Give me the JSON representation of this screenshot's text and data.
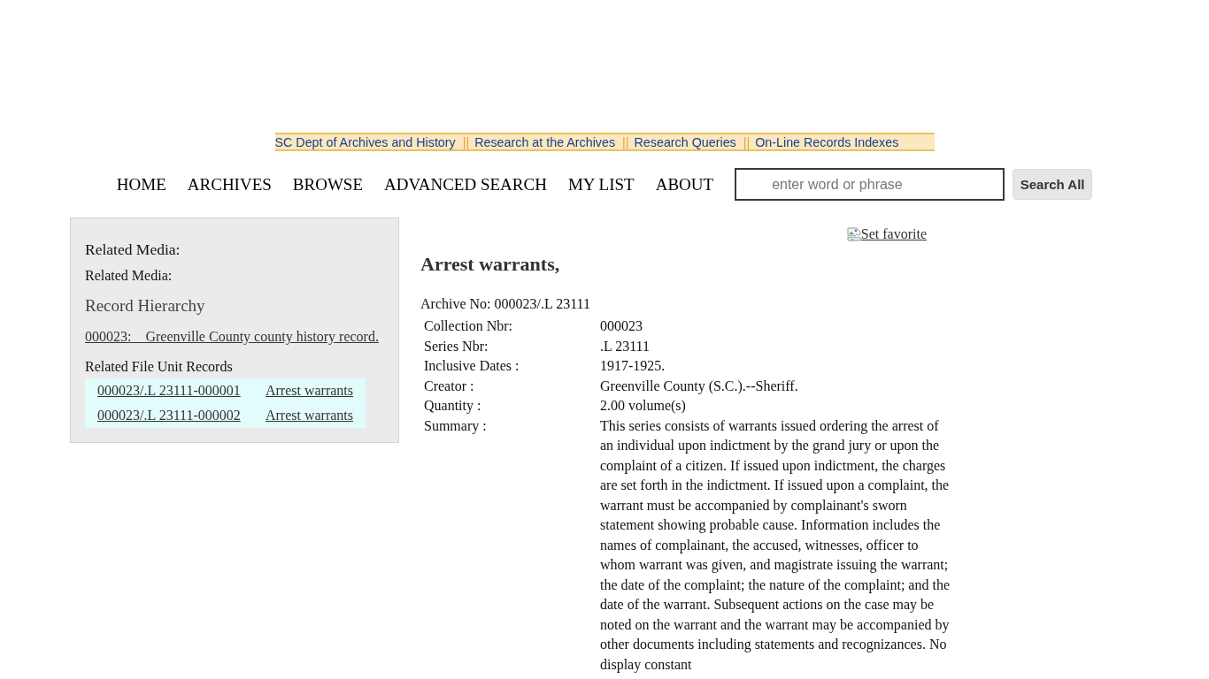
{
  "top_bar": {
    "items": [
      {
        "kind": "link",
        "label": "SC Dept of Archives and History"
      },
      {
        "kind": "separator",
        "label": "||"
      },
      {
        "kind": "link",
        "label": "Research at the Archives"
      },
      {
        "kind": "separator",
        "label": "||"
      },
      {
        "kind": "link",
        "label": "Research Queries"
      },
      {
        "kind": "separator",
        "label": "||"
      },
      {
        "kind": "link",
        "label": "On-Line Records Indexes"
      }
    ]
  },
  "nav": {
    "items": [
      {
        "label": "HOME"
      },
      {
        "label": "ARCHIVES"
      },
      {
        "label": "BROWSE"
      },
      {
        "label": "ADVANCED SEARCH"
      },
      {
        "label": "MY LIST"
      },
      {
        "label": "ABOUT"
      }
    ]
  },
  "search": {
    "placeholder": "enter word or phrase",
    "button": "Search All"
  },
  "sidebar": {
    "heading": "Related Media:",
    "subheading": "Related Media:",
    "hierarchy_title": "Record Hierarchy",
    "hierarchy_link": "000023:    Greenville County county history record.",
    "related_files": {
      "title": "Related File Unit Records",
      "rows": [
        {
          "number": "000023/.L 23111-000001",
          "title": "Arrest warrants"
        },
        {
          "number": "000023/.L 23111-000002",
          "title": "Arrest warrants"
        }
      ]
    }
  },
  "record": {
    "favorite_link": "Set favorite",
    "title": "Arrest warrants,",
    "archive_no": "Archive No: 000023/.L 23111",
    "fields": [
      {
        "label": "Collection Nbr:",
        "value": "000023"
      },
      {
        "label": "Series Nbr:",
        "value": ".L 23111"
      },
      {
        "label": "Inclusive Dates :",
        "value": "1917-1925."
      },
      {
        "label": "Creator :",
        "value": "Greenville County (S.C.).--Sheriff."
      },
      {
        "label": "Quantity :",
        "value": "2.00 volume(s)"
      },
      {
        "label": "Summary :",
        "value": "This series consists of warrants issued ordering the arrest of an individual upon indictment by the grand jury or upon the complaint of a citizen. If issued upon indictment, the charges are set forth in the indictment. If issued upon a complaint, the warrant must be accompanied by complainant's sworn statement showing probable cause. Information includes the names of complainant, the accused, witnesses, officer to whom warrant was given, and magistrate issuing the warrant; the date of the complaint; the nature of the complaint; and the date of the warrant. Subsequent actions on the case may be noted on the warrant and the warrant may be accompanied by other documents including statements and recognizances. No display constant"
      }
    ]
  }
}
